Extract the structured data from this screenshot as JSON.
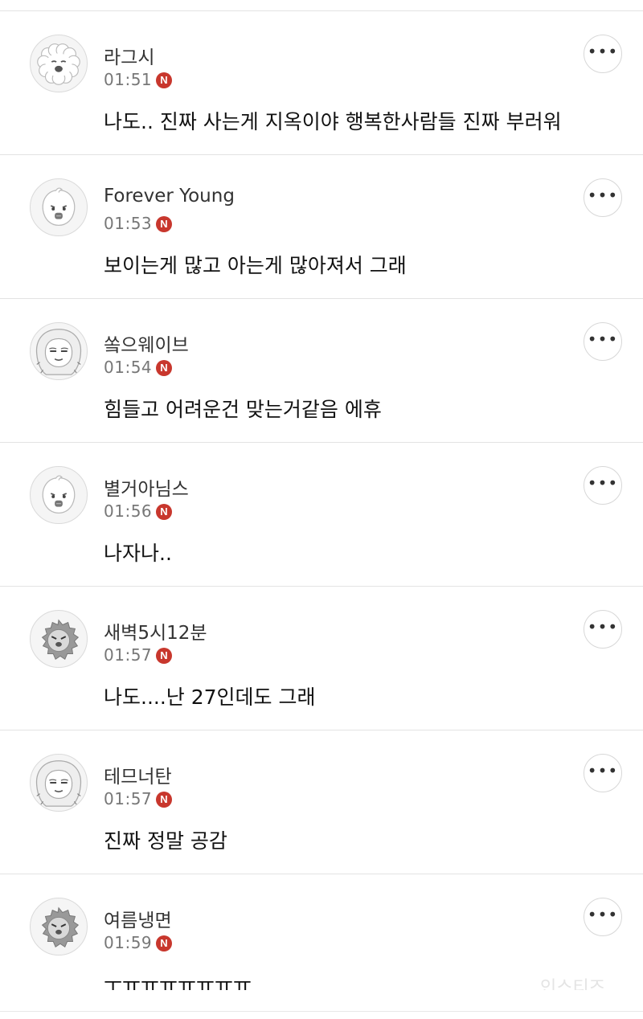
{
  "comments": [
    {
      "nickname": "라그시",
      "time": "01:51",
      "badge": "N",
      "text": "나도.. 진짜 사는게 지옥이야 행복한사람들 진짜 부러워",
      "more": "•••",
      "avatar": "fluffy-dog-avatar-icon"
    },
    {
      "nickname": "Forever Young",
      "time": "01:53",
      "badge": "N",
      "text": "보이는게 많고 아는게 많아져서 그래",
      "more": "•••",
      "avatar": "round-face-avatar-icon"
    },
    {
      "nickname": "쏰으웨이브",
      "time": "01:54",
      "badge": "N",
      "text": "힘들고 어려운건 맞는거같음 에휴",
      "more": "•••",
      "avatar": "hooded-face-avatar-icon"
    },
    {
      "nickname": "별거아님스",
      "time": "01:56",
      "badge": "N",
      "text": "나자나..",
      "more": "•••",
      "avatar": "round-face-avatar-icon"
    },
    {
      "nickname": "새벽5시12분",
      "time": "01:57",
      "badge": "N",
      "text": "나도....난 27인데도 그래",
      "more": "•••",
      "avatar": "lion-face-avatar-icon"
    },
    {
      "nickname": "테므너탄",
      "time": "01:57",
      "badge": "N",
      "text": "진짜 정말 공감",
      "more": "•••",
      "avatar": "hooded-face-avatar-icon"
    },
    {
      "nickname": "여름냉면",
      "time": "01:59",
      "badge": "N",
      "text": "ㅜㅠㅠㅠㅠㅠㅠㅠ",
      "more": "•••",
      "avatar": "lion-face-avatar-icon"
    }
  ],
  "watermark": "인스티즈"
}
